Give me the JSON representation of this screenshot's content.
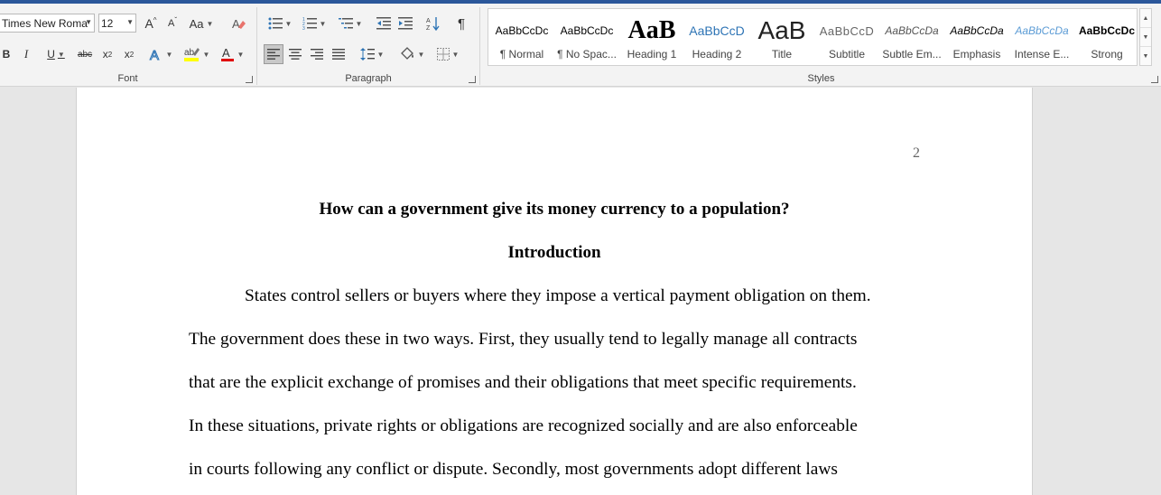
{
  "ribbon": {
    "font_group": {
      "label": "Font",
      "font_name": "Times New Roma",
      "font_size": "12",
      "grow_label": "A",
      "shrink_label": "A",
      "change_case_label": "Aa",
      "bold_label": "B",
      "italic_label": "I",
      "underline_label": "U",
      "strike_label": "abc",
      "subscript_label": "x",
      "subscript_suffix": "2",
      "superscript_label": "x",
      "superscript_suffix": "2",
      "highlight_color": "#ffff00",
      "font_color": "#e00000"
    },
    "paragraph_group": {
      "label": "Paragraph"
    },
    "styles_group": {
      "label": "Styles",
      "items": [
        {
          "sample": "AaBbCcDc",
          "name": "¶ Normal"
        },
        {
          "sample": "AaBbCcDc",
          "name": "¶ No Spac..."
        },
        {
          "sample": "AaB",
          "name": "Heading 1"
        },
        {
          "sample": "AaBbCcD",
          "name": "Heading 2"
        },
        {
          "sample": "AaB",
          "name": "Title"
        },
        {
          "sample": "AaBbCcD",
          "name": "Subtitle"
        },
        {
          "sample": "AaBbCcDa",
          "name": "Subtle Em..."
        },
        {
          "sample": "AaBbCcDa",
          "name": "Emphasis"
        },
        {
          "sample": "AaBbCcDa",
          "name": "Intense E..."
        },
        {
          "sample": "AaBbCcDc",
          "name": "Strong"
        }
      ]
    }
  },
  "document": {
    "page_number": "2",
    "title": "How can a government give its money currency to a population?",
    "heading": "Introduction",
    "lines": [
      "States control sellers or buyers where they impose a vertical payment obligation on them.",
      "The government does these in two ways. First, they usually tend to legally manage all contracts",
      "that are the explicit exchange of promises and their obligations that meet specific requirements.",
      "In these situations, private rights or obligations are recognized socially and are also enforceable",
      "in courts following any conflict or dispute. Secondly, most governments adopt different laws"
    ]
  },
  "colors": {
    "accent": "#2b579a",
    "heading2_blue": "#2e74b5"
  }
}
